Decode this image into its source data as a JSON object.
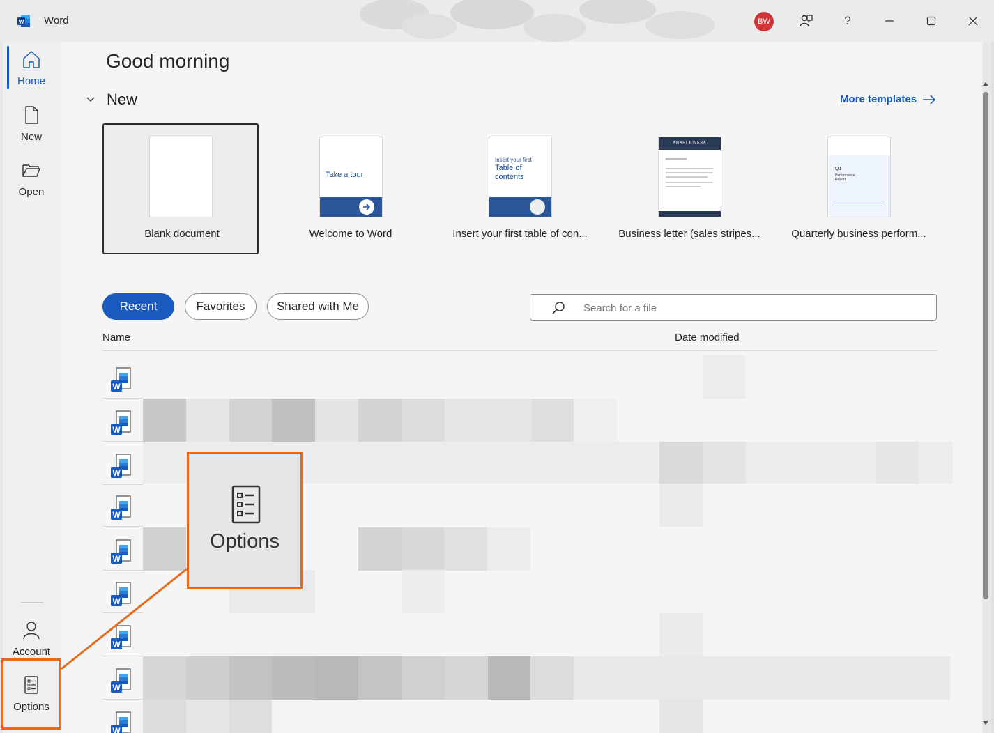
{
  "titlebar": {
    "app_name": "Word",
    "avatar_initials": "BW",
    "help_label": "?"
  },
  "sidebar": {
    "items": [
      {
        "label": "Home"
      },
      {
        "label": "New"
      },
      {
        "label": "Open"
      },
      {
        "label": "Account"
      },
      {
        "label": "Options"
      }
    ]
  },
  "main": {
    "greeting": "Good morning",
    "new_section_title": "New",
    "more_templates": "More templates",
    "templates": [
      {
        "label": "Blank document"
      },
      {
        "label": "Welcome to Word",
        "thumb_text": "Take a tour"
      },
      {
        "label": "Insert your first table of con...",
        "thumb_text_1": "Insert your first",
        "thumb_text_2": "Table of",
        "thumb_text_3": "contents"
      },
      {
        "label": "Business letter (sales stripes...",
        "thumb_text": "AMARI RIVERA"
      },
      {
        "label": "Quarterly business perform...",
        "thumb_text_1": "Q1",
        "thumb_text_2": "Performance",
        "thumb_text_3": "Report"
      }
    ],
    "tabs": [
      {
        "label": "Recent"
      },
      {
        "label": "Favorites"
      },
      {
        "label": "Shared with Me"
      }
    ],
    "search_placeholder": "Search for a file",
    "columns": {
      "name": "Name",
      "date": "Date modified"
    }
  },
  "callout": {
    "label": "Options"
  },
  "colors": {
    "accent": "#185abd",
    "highlight": "#e86a1a",
    "avatar": "#d13438"
  }
}
